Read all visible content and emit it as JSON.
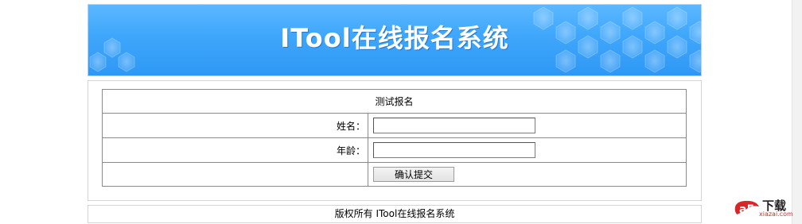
{
  "banner": {
    "title": "ITool在线报名系统"
  },
  "form": {
    "caption": "测试报名",
    "fields": [
      {
        "label": "姓名：",
        "value": "",
        "placeholder": ""
      },
      {
        "label": "年龄：",
        "value": "",
        "placeholder": ""
      }
    ],
    "submit_label": "确认提交"
  },
  "footer": {
    "text": "版权所有 ITool在线报名系统"
  },
  "watermark": {
    "logo_letters": "a5",
    "brand": "下载",
    "site": "xiazai.com"
  },
  "colors": {
    "banner_top": "#5cb8ff",
    "banner_bottom": "#2f98f4",
    "banner_text": "#ffffff",
    "table_border": "#8a8a8a",
    "panel_border": "#d5d5d5",
    "watermark_red": "#d6262a"
  }
}
